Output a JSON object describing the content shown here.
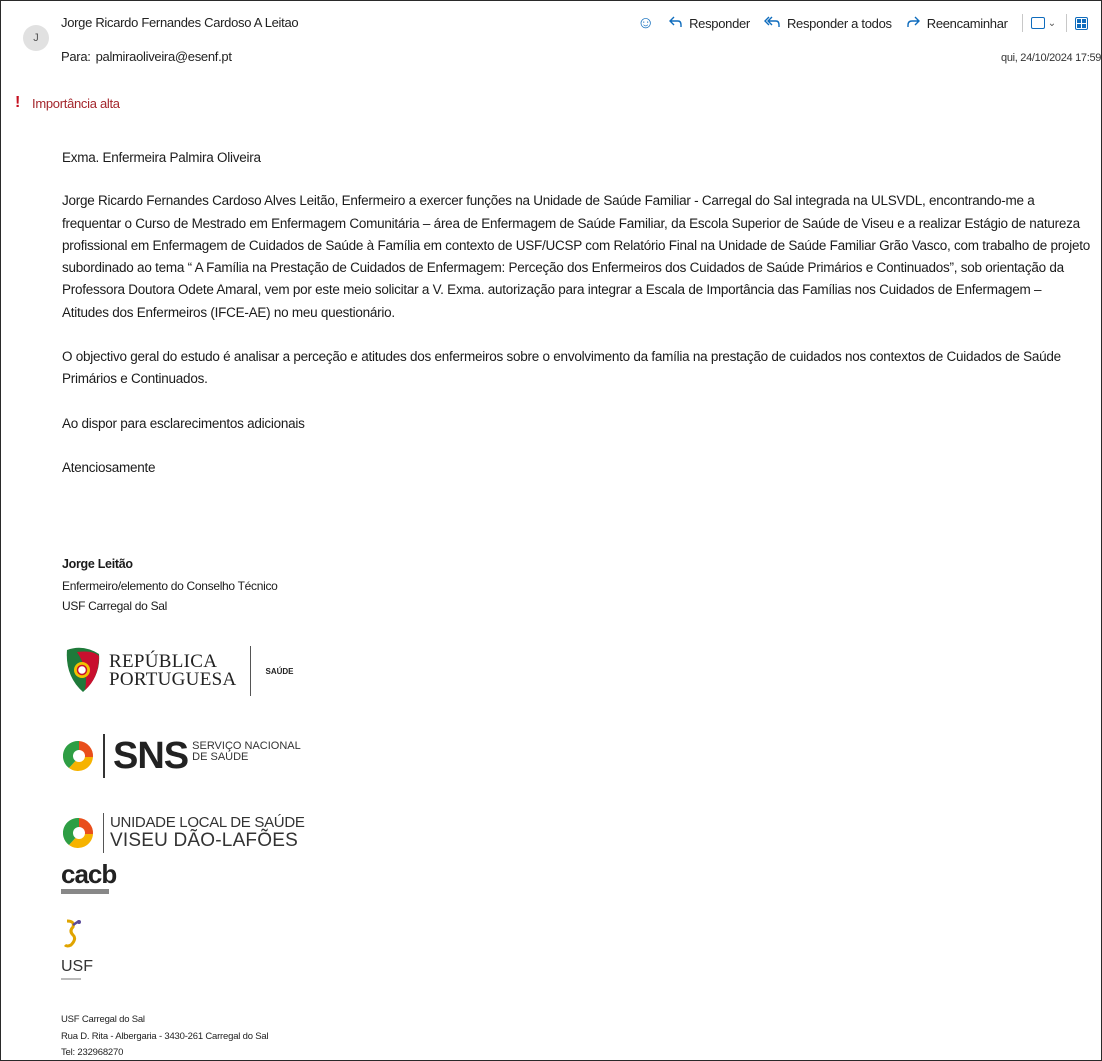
{
  "header": {
    "avatar_initial": "J",
    "sender_name": "Jorge Ricardo Fernandes Cardoso A Leitao",
    "to_label": "Para:",
    "to_address": "palmiraoliveira@esenf.pt",
    "date": "qui, 24/10/2024 17:59",
    "actions": {
      "reply": "Responder",
      "reply_all": "Responder a todos",
      "forward": "Reencaminhar"
    },
    "icons": [
      "smiley-icon",
      "reply-icon",
      "reply-all-icon",
      "forward-icon",
      "message-view-icon",
      "apps-icon",
      "more-icon"
    ]
  },
  "importance": "Importância alta",
  "body": {
    "greeting": "Exma. Enfermeira Palmira Oliveira",
    "paragraph1": [
      "Jorge Ricardo Fernandes Cardoso Alves Leitão, Enfermeiro a exercer funções na Unidade de Saúde Familiar - Carregal do Sal integrada na ULSVDL, encontrando-me a",
      "frequentar o Curso de Mestrado em Enfermagem Comunitária – área de Enfermagem de Saúde Familiar, da Escola Superior de Saúde de Viseu e a realizar Estágio de natureza",
      "profissional em Enfermagem de Cuidados de Saúde à Família em contexto de USF/UCSP com Relatório Final na Unidade de Saúde Familiar Grão Vasco, com trabalho de projeto",
      "subordinado ao tema “ A Família na Prestação de Cuidados de Enfermagem: Perceção dos Enfermeiros dos Cuidados de Saúde Primários e Continuados”, sob orientação da",
      "Professora Doutora Odete Amaral, vem por este meio solicitar a V. Exma. autorização para integrar a Escala de Importância das Famílias nos Cuidados de Enfermagem –",
      "Atitudes dos Enfermeiros (IFCE-AE) no meu questionário."
    ],
    "paragraph2": [
      "O objectivo geral do estudo é analisar a perceção e atitudes dos enfermeiros sobre o envolvimento da família na prestação de cuidados nos contextos de Cuidados de Saúde",
      "Primários  e Continuados."
    ],
    "paragraph3": "Ao dispor  para esclarecimentos adicionais",
    "closing": "Atenciosamente"
  },
  "signature": {
    "name": "Jorge Leitão",
    "role": "Enfermeiro/elemento do Conselho Técnico",
    "unit": "USF Carregal do Sal"
  },
  "logos": {
    "republica_line1": "REPÚBLICA",
    "republica_line2": "PORTUGUESA",
    "republica_saude": "SAÚDE",
    "sns_big": "SNS",
    "sns_small1": "SERVIÇO NACIONAL",
    "sns_small2": "DE SAÚDE",
    "uls_line1": "UNIDADE LOCAL DE SAÚDE",
    "uls_line2": "VISEU DÃO-LAFÕES",
    "cacb": "cacb",
    "usf": "USF"
  },
  "footer": {
    "name": "USF Carregal do Sal",
    "address": "Rua D. Rita - Albergaria - 3430-261 Carregal do Sal",
    "phone": "Tel: 232968270"
  },
  "colors": {
    "accent": "#0f6cbd",
    "importance": "#a4262c"
  }
}
